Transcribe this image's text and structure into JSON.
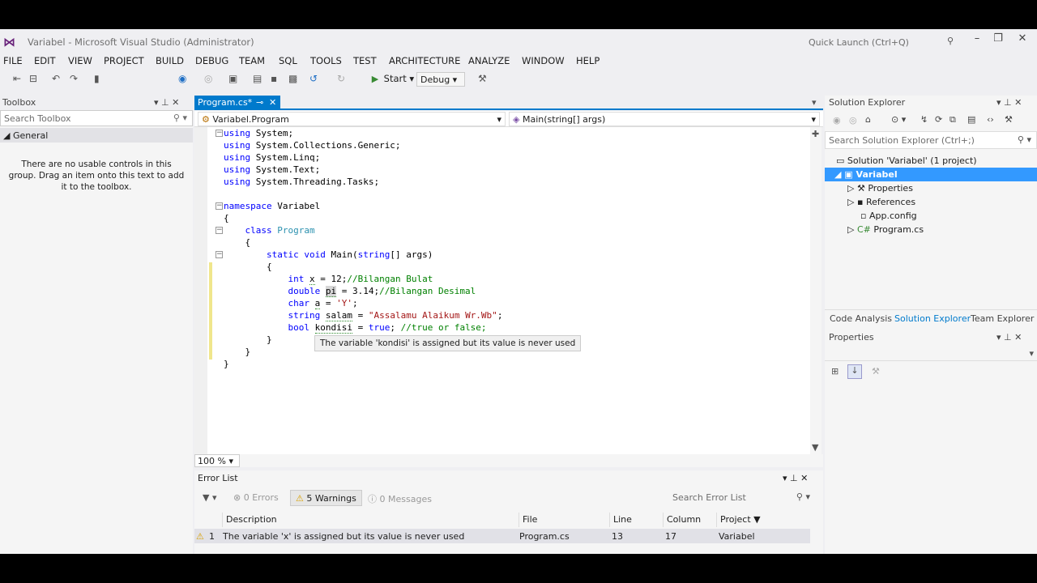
{
  "window": {
    "title": "Variabel - Microsoft Visual Studio (Administrator)",
    "quick_launch_placeholder": "Quick Launch (Ctrl+Q)"
  },
  "menu": [
    "FILE",
    "EDIT",
    "VIEW",
    "PROJECT",
    "BUILD",
    "DEBUG",
    "TEAM",
    "SQL",
    "TOOLS",
    "TEST",
    "ARCHITECTURE",
    "ANALYZE",
    "WINDOW",
    "HELP"
  ],
  "toolbar": {
    "start_label": "Start",
    "config": "Debug"
  },
  "toolbox": {
    "title": "Toolbox",
    "search_placeholder": "Search Toolbox",
    "group": "General",
    "empty_message": "There are no usable controls in this group. Drag an item onto this text to add it to the toolbox."
  },
  "editor": {
    "tab": "Program.cs*",
    "nav_left": "Variabel.Program",
    "nav_right": "Main(string[] args)",
    "zoom": "100 %",
    "tooltip": "The variable 'kondisi' is assigned but its value is never used"
  },
  "code": {
    "l1_kw": "using",
    "l1_rest": " System;",
    "l2_kw": "using",
    "l2_rest": " System.Collections.Generic;",
    "l3_kw": "using",
    "l3_rest": " System.Linq;",
    "l4_kw": "using",
    "l4_rest": " System.Text;",
    "l5_kw": "using",
    "l5_rest": " System.Threading.Tasks;",
    "l7_kw": "namespace",
    "l7_rest": " Variabel",
    "brace_open": "{",
    "brace_close": "}",
    "l9_kw": "class",
    "l9_ty": "Program",
    "l11_kw1": "static",
    "l11_kw2": "void",
    "l11_rest": " Main(",
    "l11_kw3": "string",
    "l11_rest2": "[] args)",
    "l13_kw": "int",
    "l13_var": "x",
    "l13_mid": " = 12;",
    "l13_cm": "//Bilangan Bulat",
    "l14_kw": "double",
    "l14_var": "pi",
    "l14_mid": " = 3.14;",
    "l14_cm": "//Bilangan Desimal",
    "l15_kw": "char",
    "l15_var": "a",
    "l15_mid": " = ",
    "l15_str": "'Y'",
    "l15_end": ";",
    "l16_kw": "string",
    "l16_var": "salam",
    "l16_mid": " = ",
    "l16_str": "\"Assalamu Alaikum Wr.Wb\"",
    "l16_end": ";",
    "l17_kw": "bool",
    "l17_var": "kondisi",
    "l17_mid": " = ",
    "l17_kw2": "true",
    "l17_end": "; ",
    "l17_cm": "//true or false;"
  },
  "error_list": {
    "title": "Error List",
    "errors": "0 Errors",
    "warnings": "5 Warnings",
    "messages": "0 Messages",
    "search_placeholder": "Search Error List",
    "columns": {
      "description": "Description",
      "file": "File",
      "line": "Line",
      "column": "Column",
      "project": "Project"
    },
    "row1": {
      "num": "1",
      "description": "The variable 'x' is assigned but its value is never used",
      "file": "Program.cs",
      "line": "13",
      "column": "17",
      "project": "Variabel"
    }
  },
  "solution_explorer": {
    "title": "Solution Explorer",
    "search_placeholder": "Search Solution Explorer (Ctrl+;)",
    "solution": "Solution 'Variabel' (1 project)",
    "project": "Variabel",
    "items": [
      "Properties",
      "References",
      "App.config",
      "Program.cs"
    ],
    "tabs": [
      "Code Analysis",
      "Solution Explorer",
      "Team Explorer"
    ]
  },
  "properties": {
    "title": "Properties"
  },
  "colors": {
    "accent": "#007acc",
    "keyword": "#0000ff",
    "type": "#2b91af",
    "string": "#a31515",
    "comment": "#008000"
  }
}
